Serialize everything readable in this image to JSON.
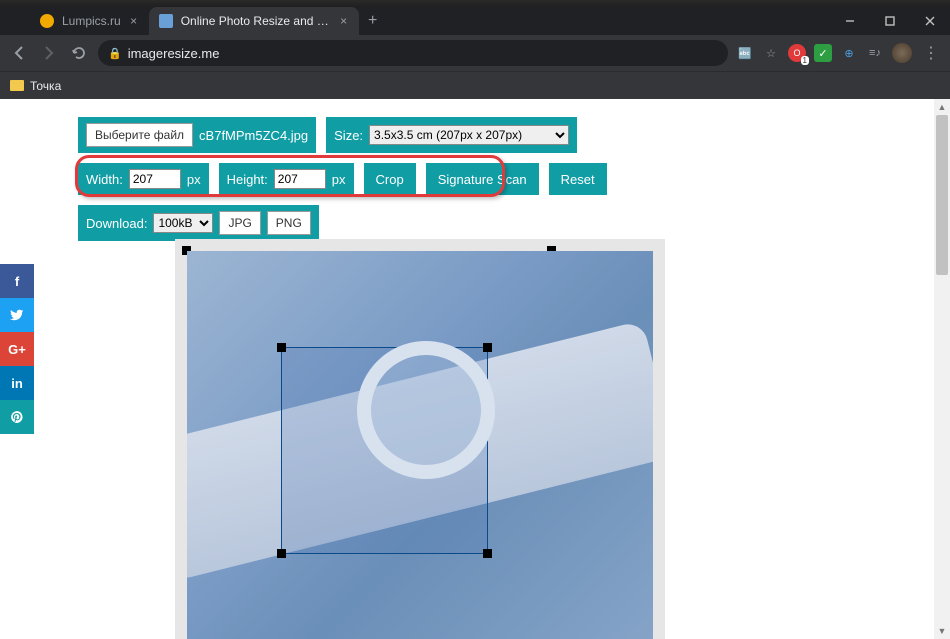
{
  "browser": {
    "tabs": [
      {
        "title": "Lumpics.ru"
      },
      {
        "title": "Online Photo Resize and Crop | F"
      }
    ],
    "url": "imageresize.me",
    "bookmark": "Точка"
  },
  "toolbar": {
    "choose_file_label": "Выберите файл",
    "filename": "cB7fMPm5ZC4.jpg",
    "size_label": "Size:",
    "size_value": "3.5x3.5 cm (207px x 207px)",
    "width_label": "Width:",
    "width_value": "207",
    "height_label": "Height:",
    "height_value": "207",
    "unit": "px",
    "crop_label": "Crop",
    "sigscan_label": "Signature Scan",
    "reset_label": "Reset",
    "download_label": "Download:",
    "download_size": "100kB",
    "jpg_label": "JPG",
    "png_label": "PNG"
  },
  "social": {
    "fb": "f",
    "tw": "",
    "gp": "G+",
    "li": "in",
    "pi": ""
  }
}
